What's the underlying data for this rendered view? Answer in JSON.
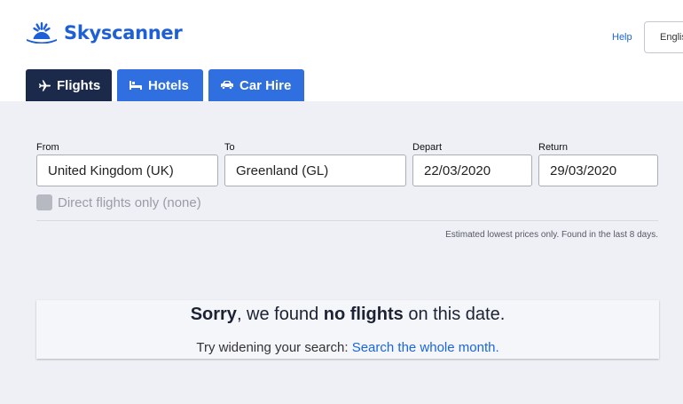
{
  "brand": {
    "name": "Skyscanner",
    "color": "#1f5fd6"
  },
  "header": {
    "help_label": "Help",
    "language_label": "English"
  },
  "tabs": [
    {
      "label": "Flights",
      "icon": "plane-icon",
      "active": true
    },
    {
      "label": "Hotels",
      "icon": "bed-icon",
      "active": false
    },
    {
      "label": "Car Hire",
      "icon": "car-icon",
      "active": false
    }
  ],
  "search": {
    "from": {
      "label": "From",
      "value": "United Kingdom (UK)"
    },
    "to": {
      "label": "To",
      "value": "Greenland (GL)"
    },
    "depart": {
      "label": "Depart",
      "value": "22/03/2020"
    },
    "return": {
      "label": "Return",
      "value": "29/03/2020"
    },
    "direct_only_label": "Direct flights only (none)",
    "direct_only_checked": false
  },
  "estimate_note": "Estimated lowest prices only. Found in the last 8 days.",
  "result": {
    "sorry_word": "Sorry",
    "sorry_middle": ", we found ",
    "no_flights": "no flights",
    "sorry_end": " on this date.",
    "try_text": "Try widening your search: ",
    "whole_month_link": "Search the whole month."
  },
  "colors": {
    "active_tab": "#1b2a4a",
    "tab": "#2f6fe0",
    "link": "#1a66e0",
    "panel_bg": "#eff0f6"
  }
}
